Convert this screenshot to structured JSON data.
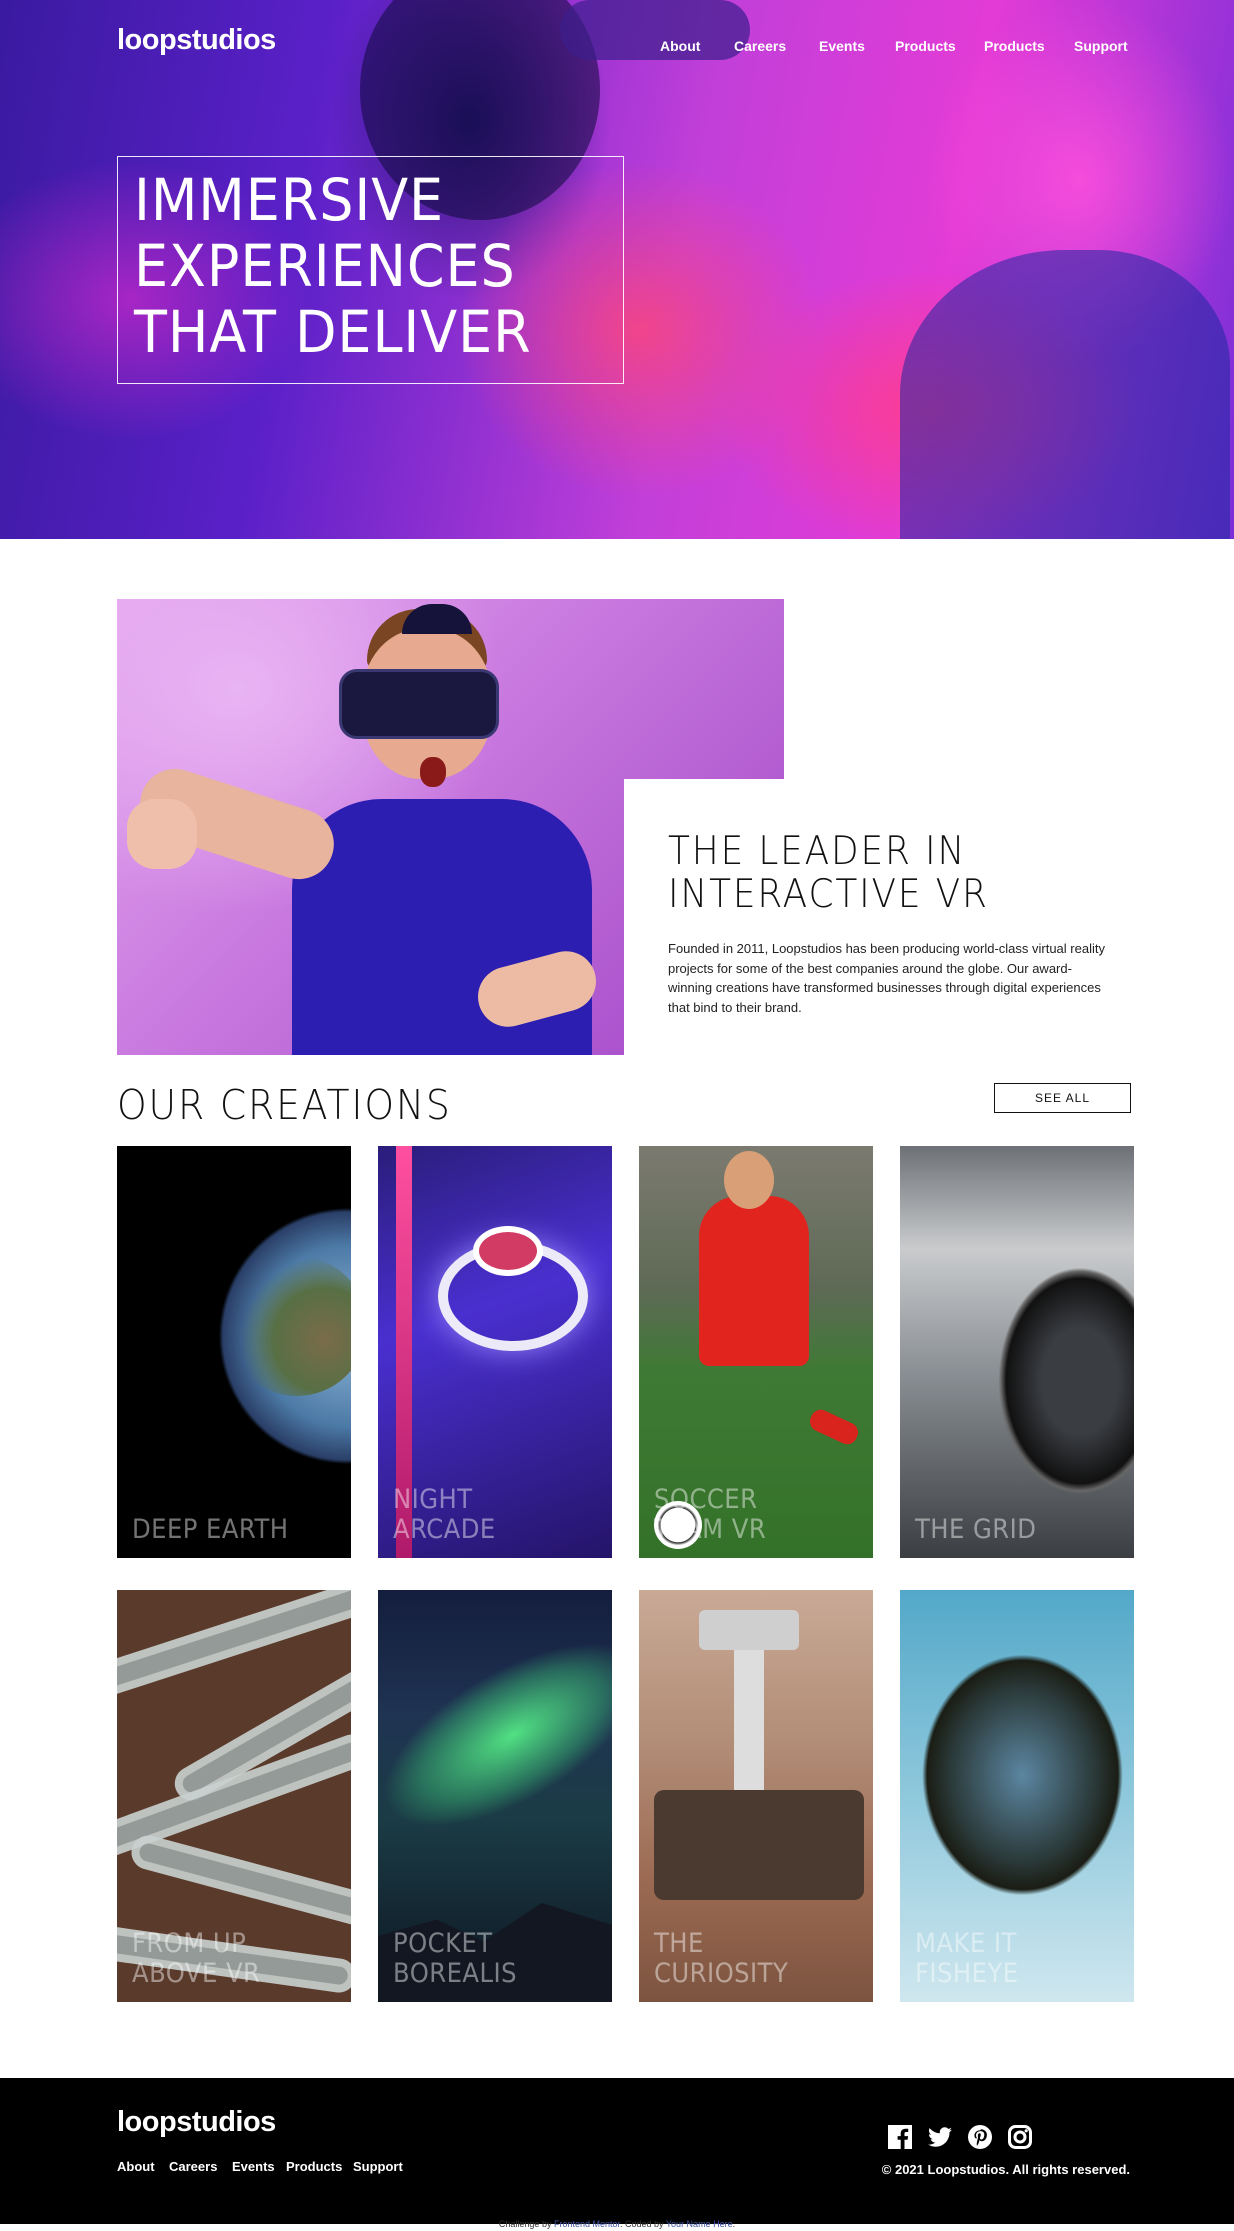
{
  "header": {
    "logo": "loopstudios",
    "nav": [
      "About",
      "Careers",
      "Events",
      "Products",
      "Products",
      "Support"
    ]
  },
  "hero": {
    "title_lines": [
      "IMMERSIVE",
      "EXPERIENCES",
      "THAT DELIVER"
    ]
  },
  "leader": {
    "title_lines": [
      "THE LEADER IN",
      "INTERACTIVE VR"
    ],
    "text": "Founded in 2011, Loopstudios has been producing world-class virtual reality projects for some of the best companies around the globe. Our award-winning creations have transformed businesses through digital experiences that bind to their brand."
  },
  "creations": {
    "title": "OUR CREATIONS",
    "see_all": "SEE ALL",
    "cards": [
      {
        "label_lines": [
          "DEEP EARTH"
        ]
      },
      {
        "label_lines": [
          "NIGHT",
          "ARCADE"
        ]
      },
      {
        "label_lines": [
          "SOCCER",
          "TEAM VR"
        ]
      },
      {
        "label_lines": [
          "THE GRID"
        ]
      },
      {
        "label_lines": [
          "FROM UP",
          "ABOVE VR"
        ]
      },
      {
        "label_lines": [
          "POCKET",
          "BOREALIS"
        ]
      },
      {
        "label_lines": [
          "THE",
          "CURIOSITY"
        ]
      },
      {
        "label_lines": [
          "MAKE IT",
          "FISHEYE"
        ]
      }
    ]
  },
  "footer": {
    "logo": "loopstudios",
    "nav": [
      "About",
      "Careers",
      "Events",
      "Products",
      "Support"
    ],
    "social_icons": [
      "facebook-icon",
      "twitter-icon",
      "pinterest-icon",
      "instagram-icon"
    ],
    "copyright": "© 2021 Loopstudios. All rights reserved."
  },
  "attribution": {
    "prefix": "Challenge by ",
    "link1": "Frontend Mentor",
    "middle": ". Coded by ",
    "link2": "Your Name Here",
    "suffix": "."
  }
}
